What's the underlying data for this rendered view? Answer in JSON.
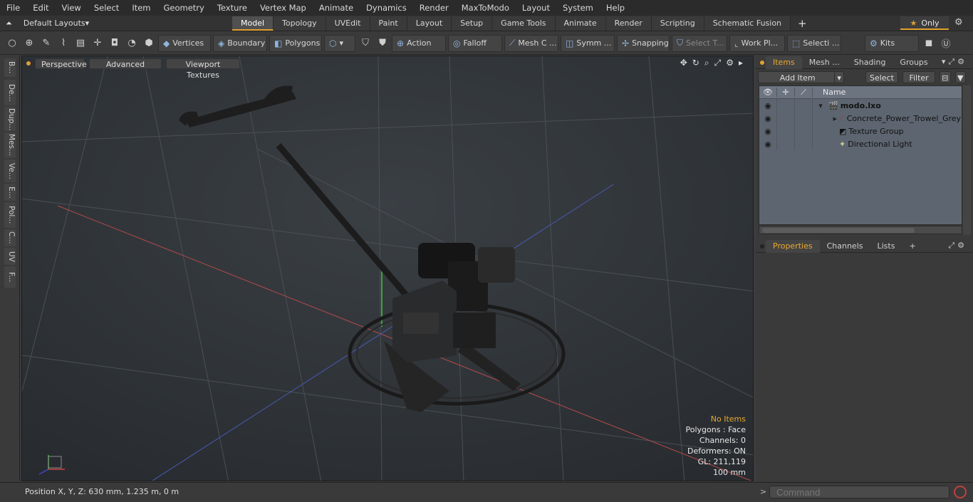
{
  "menu": [
    "File",
    "Edit",
    "View",
    "Select",
    "Item",
    "Geometry",
    "Texture",
    "Vertex Map",
    "Animate",
    "Dynamics",
    "Render",
    "MaxToModo",
    "Layout",
    "System",
    "Help"
  ],
  "layouts": {
    "label": "Default Layouts"
  },
  "tabs": [
    "Model",
    "Topology",
    "UVEdit",
    "Paint",
    "Layout",
    "Setup",
    "Game Tools",
    "Animate",
    "Render",
    "Scripting",
    "Schematic Fusion"
  ],
  "only_label": "Only",
  "toolbar": {
    "vertices": "Vertices",
    "boundary": "Boundary",
    "polygons": "Polygons",
    "action": "Action",
    "falloff": "Falloff",
    "mesh": "Mesh C ...",
    "symm": "Symm ...",
    "snapping": "Snapping",
    "select_t": "Select T...",
    "work_pl": "Work Pl...",
    "selecti": "Selecti ...",
    "kits": "Kits"
  },
  "left_tabs": [
    "B...",
    "De...",
    "Dup...",
    "Mes...",
    "Ve...",
    "E...",
    "Pol...",
    "C...",
    "UV",
    "F..."
  ],
  "viewport": {
    "perspective": "Perspective",
    "advanced": "Advanced",
    "textures": "Viewport Textures",
    "stats": [
      "No Items",
      "Polygons : Face",
      "Channels: 0",
      "Deformers: ON",
      "GL: 211,119",
      "100 mm"
    ]
  },
  "status": {
    "position": "Position X, Y, Z:   630 mm, 1.235 m, 0 m",
    "command_placeholder": "Command"
  },
  "items_panel": {
    "tabs": [
      "Items",
      "Mesh ...",
      "Shading",
      "Groups"
    ],
    "add_item": "Add Item",
    "select": "Select",
    "filter": "Filter",
    "name_header": "Name",
    "rows": [
      {
        "name": "modo.lxo"
      },
      {
        "name": "Concrete_Power_Trowel_Grey"
      },
      {
        "name": "Texture Group"
      },
      {
        "name": "Directional Light"
      }
    ]
  },
  "props_panel": {
    "tabs": [
      "Properties",
      "Channels",
      "Lists"
    ]
  }
}
